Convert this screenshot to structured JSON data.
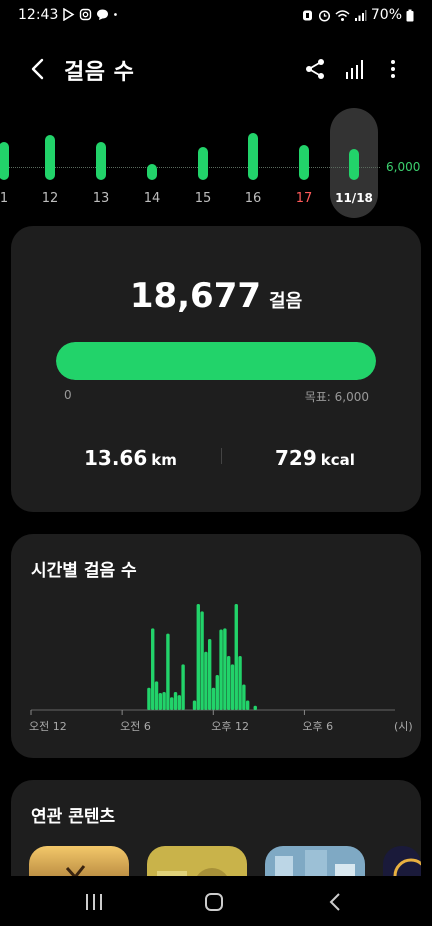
{
  "status": {
    "time": "12:43",
    "battery": "70%",
    "left_icons": [
      "play-store-icon",
      "instagram-icon",
      "chat-icon",
      "dot-icon"
    ],
    "right_icons": [
      "alarm-icon",
      "clock-icon",
      "wifi-icon",
      "signal-icon",
      "battery-icon"
    ]
  },
  "header": {
    "title": "걸음 수",
    "icons": [
      "share-icon",
      "chart-icon",
      "more-icon"
    ]
  },
  "week": {
    "goal_label": "6,000",
    "days": [
      {
        "label": "1",
        "steps_ratio": 0.9
      },
      {
        "label": "12",
        "steps_ratio": 1.06
      },
      {
        "label": "13",
        "steps_ratio": 0.9
      },
      {
        "label": "14",
        "steps_ratio": 0.37
      },
      {
        "label": "15",
        "steps_ratio": 0.79
      },
      {
        "label": "16",
        "steps_ratio": 1.12
      },
      {
        "label": "17",
        "steps_ratio": 0.84,
        "sunday": true
      },
      {
        "label": "11/18",
        "steps_ratio": 0.73,
        "selected": true
      }
    ]
  },
  "summary": {
    "steps": "18,677",
    "steps_unit": "걸음",
    "progress_ratio": 1.0,
    "progress_min": "0",
    "progress_goal": "목표: 6,000",
    "distance_value": "13.66",
    "distance_unit": "km",
    "calories_value": "729",
    "calories_unit": "kcal"
  },
  "hourly": {
    "title": "시간별 걸음 수",
    "x_ticks": [
      "오전 12",
      "오전 6",
      "오후 12",
      "오후 6",
      "(시)"
    ],
    "bars": [
      {
        "hour": 7.75,
        "ratio": 0.21
      },
      {
        "hour": 8.0,
        "ratio": 0.77
      },
      {
        "hour": 8.25,
        "ratio": 0.27
      },
      {
        "hour": 8.5,
        "ratio": 0.16
      },
      {
        "hour": 8.75,
        "ratio": 0.17
      },
      {
        "hour": 9.0,
        "ratio": 0.72
      },
      {
        "hour": 9.25,
        "ratio": 0.12
      },
      {
        "hour": 9.5,
        "ratio": 0.17
      },
      {
        "hour": 9.75,
        "ratio": 0.14
      },
      {
        "hour": 10.0,
        "ratio": 0.43
      },
      {
        "hour": 10.75,
        "ratio": 0.09
      },
      {
        "hour": 11.0,
        "ratio": 1.0
      },
      {
        "hour": 11.25,
        "ratio": 0.93
      },
      {
        "hour": 11.5,
        "ratio": 0.55
      },
      {
        "hour": 11.75,
        "ratio": 0.67
      },
      {
        "hour": 12.0,
        "ratio": 0.21
      },
      {
        "hour": 12.25,
        "ratio": 0.33
      },
      {
        "hour": 12.5,
        "ratio": 0.76
      },
      {
        "hour": 12.75,
        "ratio": 0.77
      },
      {
        "hour": 13.0,
        "ratio": 0.51
      },
      {
        "hour": 13.25,
        "ratio": 0.43
      },
      {
        "hour": 13.5,
        "ratio": 1.0
      },
      {
        "hour": 13.75,
        "ratio": 0.51
      },
      {
        "hour": 14.0,
        "ratio": 0.24
      },
      {
        "hour": 14.25,
        "ratio": 0.09
      },
      {
        "hour": 14.75,
        "ratio": 0.04
      }
    ]
  },
  "related": {
    "title": "연관 콘텐츠",
    "thumbs": [
      "tree-sunset-thumbnail",
      "yellow-photo-thumbnail",
      "city-photo-thumbnail",
      "lights-photo-thumbnail"
    ]
  },
  "nav": {
    "buttons": [
      "recents-button",
      "home-button",
      "back-button"
    ]
  },
  "colors": {
    "accent": "#22d36a",
    "card": "#1e1e1e",
    "sunday": "#ff5a5a"
  }
}
